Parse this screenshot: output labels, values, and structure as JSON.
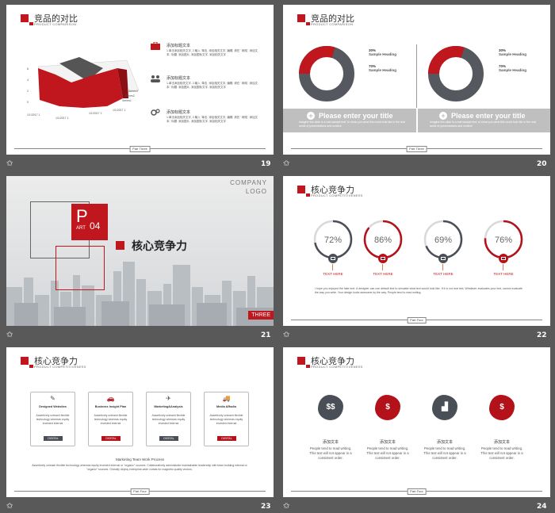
{
  "slides": {
    "s19": {
      "number": "19",
      "title": "竞品的对比",
      "subtitle": "PRODUCT   COMPARISON",
      "footer": "Part Three",
      "chart_labels": {
        "series": [
          "Series3",
          "Series2",
          "Series1"
        ],
        "dates": [
          "1/1/2017 1",
          "1/1/2017 1",
          "1/1/2017 1",
          "1/1/2017 1"
        ],
        "yticks": [
          "6",
          "4",
          "2",
          "0"
        ]
      },
      "items": [
        {
          "title": "添加标题文本",
          "body": "1.单击添加相关文字, 2.输入 '单击, 添加相关文字, 编辑, 请在 ' 网络', 添加文本,' 标题. 添加图片, 添加图标文字, 添加相关文字"
        },
        {
          "title": "添加标题文本",
          "body": "1.单击添加相关文字, 2.输入 '单击, 添加相关文字, 编辑, 请在 ' 网络', 添加文本,' 标题. 添加图片, 添加图标文字, 添加相关文字"
        },
        {
          "title": "添加标题文本",
          "body": "1.单击添加相关文字, 2.输入 '单击, 添加相关文字, 编辑, 请在 ' 网络', 添加文本,' 标题. 添加图片, 添加图标文字, 添加相关文字"
        }
      ]
    },
    "s20": {
      "number": "20",
      "title": "竞品的对比",
      "subtitle": "PRODUCT   COMPARISON",
      "footer": "Part Three",
      "donuts": [
        {
          "pct_a": "30%",
          "label_a": "Sample Heading",
          "pct_b": "70%",
          "label_b": "Sample Heading",
          "value": 0.3
        },
        {
          "pct_a": "30%",
          "label_a": "Sample Heading",
          "pct_b": "70%",
          "label_b": "Sample Heading",
          "value": 0.3
        }
      ],
      "banners": [
        {
          "title": "Please enter your title",
          "body": "Imagine this slide is a real sample text, to show you what this could look like in the real world of presentations and content"
        },
        {
          "title": "Please enter your title",
          "body": "Imagine this slide is a real sample text, to show you what this could look like in the real world of presentations and content"
        }
      ]
    },
    "s21": {
      "number": "21",
      "company": "COMPANY",
      "logo": "LOGO",
      "part_p": "P",
      "part_art": "ART",
      "part_num": "04",
      "title": "核心竞争力",
      "tag": "THREE"
    },
    "s22": {
      "number": "22",
      "title": "核心竞争力",
      "subtitle": "PRODUCT   COMPETITIVENESS",
      "footer": "Part Four",
      "rings": [
        {
          "value": "72%",
          "label": "TEXT HERE",
          "fraction": 0.72,
          "color": "#4a4f57"
        },
        {
          "value": "86%",
          "label": "TEXT HERE",
          "fraction": 0.86,
          "color": "#b3121b"
        },
        {
          "value": "69%",
          "label": "TEXT HERE",
          "fraction": 0.69,
          "color": "#4a4f57"
        },
        {
          "value": "76%",
          "label": "TEXT HERE",
          "fraction": 0.76,
          "color": "#b3121b"
        }
      ],
      "paragraph": "I hope you enjoyed the fake text. A designer can use default text to simulate what text would look like. If it is not real text, Whatever evaluates your text, cannot evaluate the way you write. Your design looks awesome by the way. People tend to read writing."
    },
    "s23": {
      "number": "23",
      "title": "核心竞争力",
      "subtitle": "PRODUCT   COMPETITIVENESS",
      "footer": "Part Four",
      "cards": [
        {
          "title": "Designed Websites",
          "body": "Assertively unleash flexible technology whereas equity invested internal",
          "btn": "DIGITAL",
          "btn_color": "#4a4f57"
        },
        {
          "title": "Business Insight Plan",
          "body": "Assertively unleash flexible technology whereas equity invested internal",
          "btn": "DIGITAL",
          "btn_color": "#b3121b"
        },
        {
          "title": "Marketing&Analysis",
          "body": "Assertively unleash flexible technology whereas equity invested internal",
          "btn": "DIGITAL",
          "btn_color": "#4a4f57"
        },
        {
          "title": "Media &Radio",
          "body": "Assertively unleash flexible technology whereas equity invested internal",
          "btn": "DIGITAL",
          "btn_color": "#b3121b"
        }
      ],
      "process_title": "Marketing  Team  Work  Process",
      "process_body": "Assertively unleash flexible technology whereas equity invested internal or \"organic\" sources. Collaboratively administrate maintainable leadership with team building internal or \"organic\" sources. Globally deploy enterprise-wide vortals for magnetic quality vectors."
    },
    "s24": {
      "number": "24",
      "title": "核心竞争力",
      "subtitle": "PRODUCT   COMPETITIVENESS",
      "footer": "Part Four",
      "items": [
        {
          "title": "添加文本",
          "body": "People tend to read writing. This text will not appear in a consistent order.",
          "color": "#4a4f57"
        },
        {
          "title": "添加文本",
          "body": "People tend to read writing. This text will not appear in a consistent order.",
          "color": "#b3121b"
        },
        {
          "title": "添加文本",
          "body": "People tend to read writing. This text will not appear in a consistent order.",
          "color": "#4a4f57"
        },
        {
          "title": "添加文本",
          "body": "People tend to read writing. This text will not appear in a consistent order.",
          "color": "#b3121b"
        }
      ]
    }
  },
  "colors": {
    "accent": "#c0161d",
    "dark": "#4a4f57",
    "background": "#595959"
  }
}
